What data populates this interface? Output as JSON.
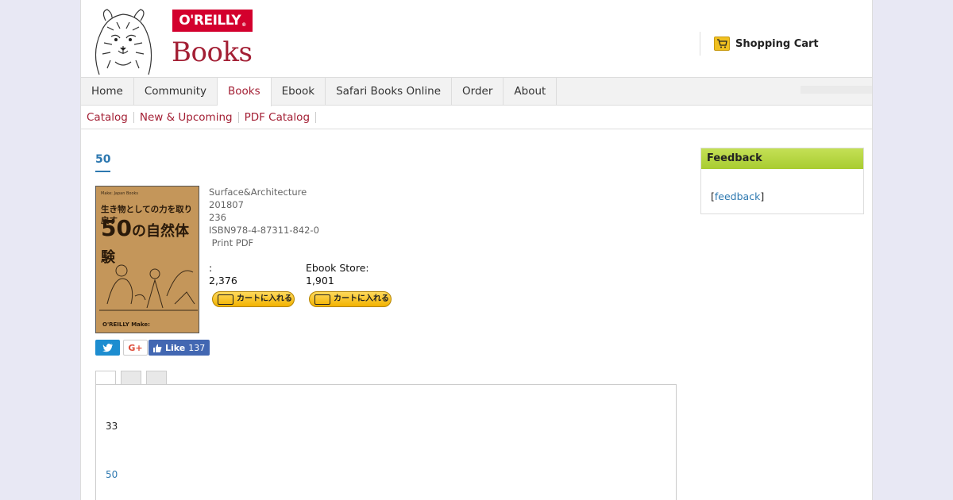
{
  "header": {
    "logo_text": "O'REILLY",
    "logo_sub": "Books",
    "cart_label": "Shopping Cart"
  },
  "nav": {
    "tabs": [
      {
        "label": "Home"
      },
      {
        "label": "Community"
      },
      {
        "label": "Books",
        "active": true
      },
      {
        "label": "Ebook"
      },
      {
        "label": "Safari Books Online"
      },
      {
        "label": "Order"
      },
      {
        "label": "About"
      }
    ]
  },
  "subnav": {
    "links": [
      "Catalog",
      "New & Upcoming",
      "PDF Catalog"
    ]
  },
  "book": {
    "title": "50",
    "series": "Surface&Architecture",
    "date": "201807",
    "pages": "236",
    "isbn": "ISBN978-4-87311-842-0",
    "formats": " Print PDF",
    "cover_top": "Make: Japan Books",
    "cover_jp": "生き物としての力を取り戻す",
    "cover_num": "50",
    "cover_jp2": "の自然体験",
    "cover_publisher": "O'REILLY   Make:",
    "print_label": ":",
    "print_price": "2,376",
    "ebook_label": "Ebook Store:",
    "ebook_price": "1,901",
    "cart_button_label": "カートに入れる"
  },
  "social": {
    "twitter": "🐦",
    "gplus": "G+",
    "fb_label": "Like",
    "fb_count": "137"
  },
  "panel": {
    "line1": "33",
    "line2": "50"
  },
  "sidebar": {
    "title": "Feedback",
    "open": "[",
    "link": "feedback",
    "close": "]"
  }
}
